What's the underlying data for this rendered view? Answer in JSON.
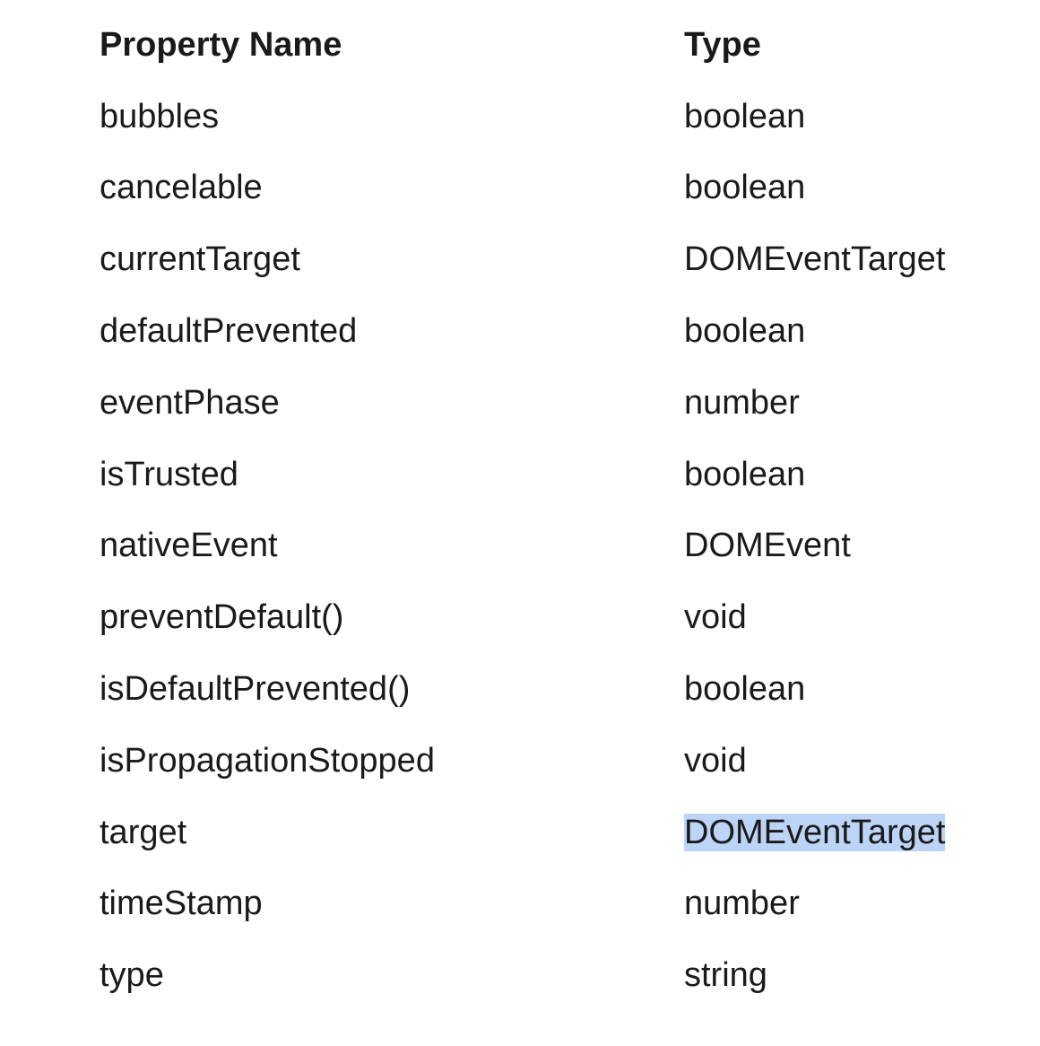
{
  "table": {
    "headers": {
      "name": "Property Name",
      "type": "Type"
    },
    "rows": [
      {
        "name": "bubbles",
        "type": "boolean"
      },
      {
        "name": "cancelable",
        "type": "boolean"
      },
      {
        "name": "currentTarget",
        "type": "DOMEventTarget"
      },
      {
        "name": "defaultPrevented",
        "type": "boolean"
      },
      {
        "name": "eventPhase",
        "type": "number"
      },
      {
        "name": "isTrusted",
        "type": "boolean"
      },
      {
        "name": "nativeEvent",
        "type": "DOMEvent"
      },
      {
        "name": "preventDefault()",
        "type": "void"
      },
      {
        "name": "isDefaultPrevented()",
        "type": "boolean"
      },
      {
        "name": "isPropagationStopped",
        "type": "void"
      },
      {
        "name": "target",
        "type": "DOMEventTarget",
        "selected": true
      },
      {
        "name": "timeStamp",
        "type": "number"
      },
      {
        "name": "type",
        "type": "string"
      }
    ]
  },
  "colors": {
    "text": "#1a1a1a",
    "selection": "#bcd4f5",
    "background": "#ffffff"
  }
}
